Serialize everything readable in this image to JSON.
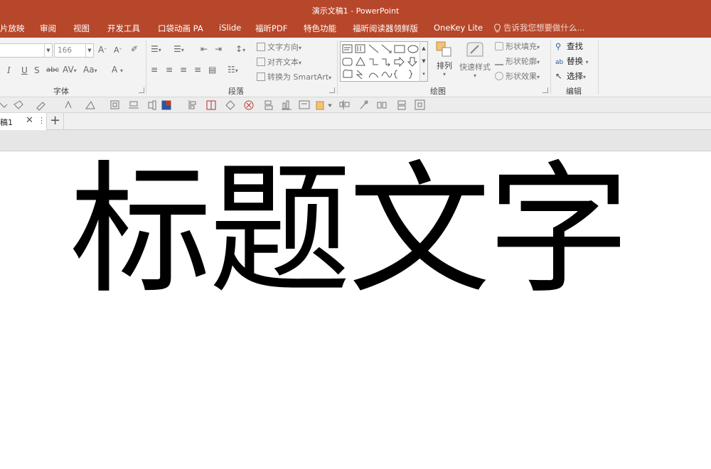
{
  "window": {
    "title": "演示文稿1 - PowerPoint"
  },
  "ribbon_tabs": [
    {
      "label": "片放映"
    },
    {
      "label": "审阅"
    },
    {
      "label": "视图"
    },
    {
      "label": "开发工具"
    },
    {
      "label": "口袋动画 PA"
    },
    {
      "label": "iSlide"
    },
    {
      "label": "福昕PDF"
    },
    {
      "label": "特色功能"
    },
    {
      "label": "福昕阅读器领鲜版"
    },
    {
      "label": "OneKey Lite"
    }
  ],
  "tell_me": {
    "placeholder": "告诉我您想要做什么..."
  },
  "font_group": {
    "label": "字体",
    "font_size": "166",
    "increase": "A",
    "decrease": "A",
    "italic": "I",
    "underline": "U",
    "shadow": "S",
    "strike": "abc",
    "spacing": "AV",
    "case": "Aa",
    "color": "A"
  },
  "paragraph_group": {
    "label": "段落",
    "text_direction": "文字方向",
    "align_text": "对齐文本",
    "smartart": "转换为 SmartArt"
  },
  "drawing_group": {
    "label": "绘图",
    "arrange": "排列",
    "quick_styles": "快速样式",
    "shape_fill": "形状填充",
    "shape_outline": "形状轮廓",
    "shape_effects": "形状效果"
  },
  "editing_group": {
    "label": "编辑",
    "find": "查找",
    "replace": "替换",
    "select": "选择"
  },
  "doc_tab": {
    "label": "稿1",
    "close": "✕",
    "more": "⋮",
    "add": "+"
  },
  "slide": {
    "title_text": "标题文字"
  },
  "colors": {
    "accent": "#b7472a",
    "ribbon_bg": "#f3f3f3",
    "slide_bg": "#ffffff"
  }
}
